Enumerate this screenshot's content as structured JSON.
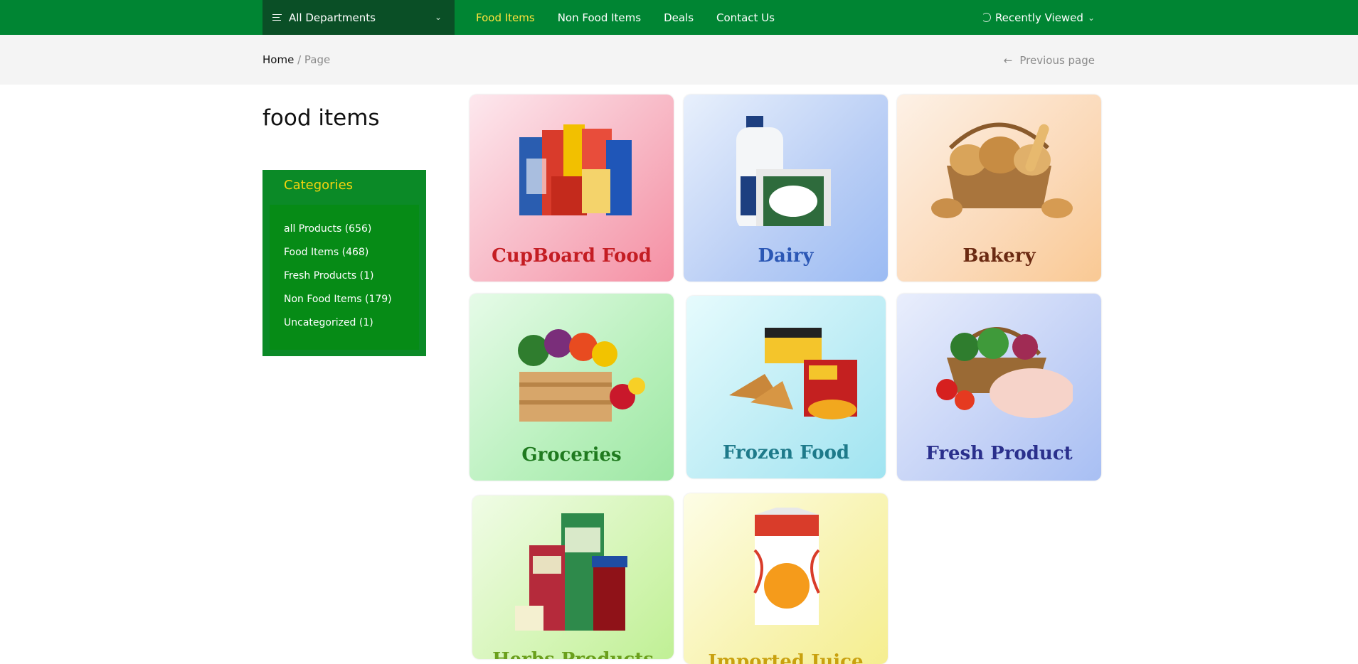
{
  "topbar": {
    "departments_label": "All Departments",
    "nav": [
      "Food Items",
      "Non Food Items",
      "Deals",
      "Contact Us"
    ],
    "active_nav": "Food Items",
    "recently_viewed": "Recently Viewed"
  },
  "breadcrumb": {
    "home": "Home",
    "separator": "/",
    "current": "Page",
    "previous": "Previous page"
  },
  "page_title": "food items",
  "categories": {
    "heading": "Categories",
    "items": [
      "all Products (656)",
      "Food Items (468)",
      "Fresh Products (1)",
      "Non Food Items (179)",
      "Uncategorized (1)"
    ]
  },
  "cards": [
    {
      "label": "CupBoard Food",
      "color": "#c41d23"
    },
    {
      "label": "Dairy",
      "color": "#2b57b5"
    },
    {
      "label": "Bakery",
      "color": "#6b2a12"
    },
    {
      "label": "Groceries",
      "color": "#1f7a1f"
    },
    {
      "label": "Frozen Food",
      "color": "#1e7a8a"
    },
    {
      "label": "Fresh Product",
      "color": "#2a2f8c"
    },
    {
      "label": "Herbs Products",
      "color": "#6a9f1c"
    },
    {
      "label": "Imported Juice",
      "color": "#c9a10f"
    }
  ],
  "colors": {
    "brand_green": "#008533",
    "accent_yellow": "#ffe23d"
  }
}
